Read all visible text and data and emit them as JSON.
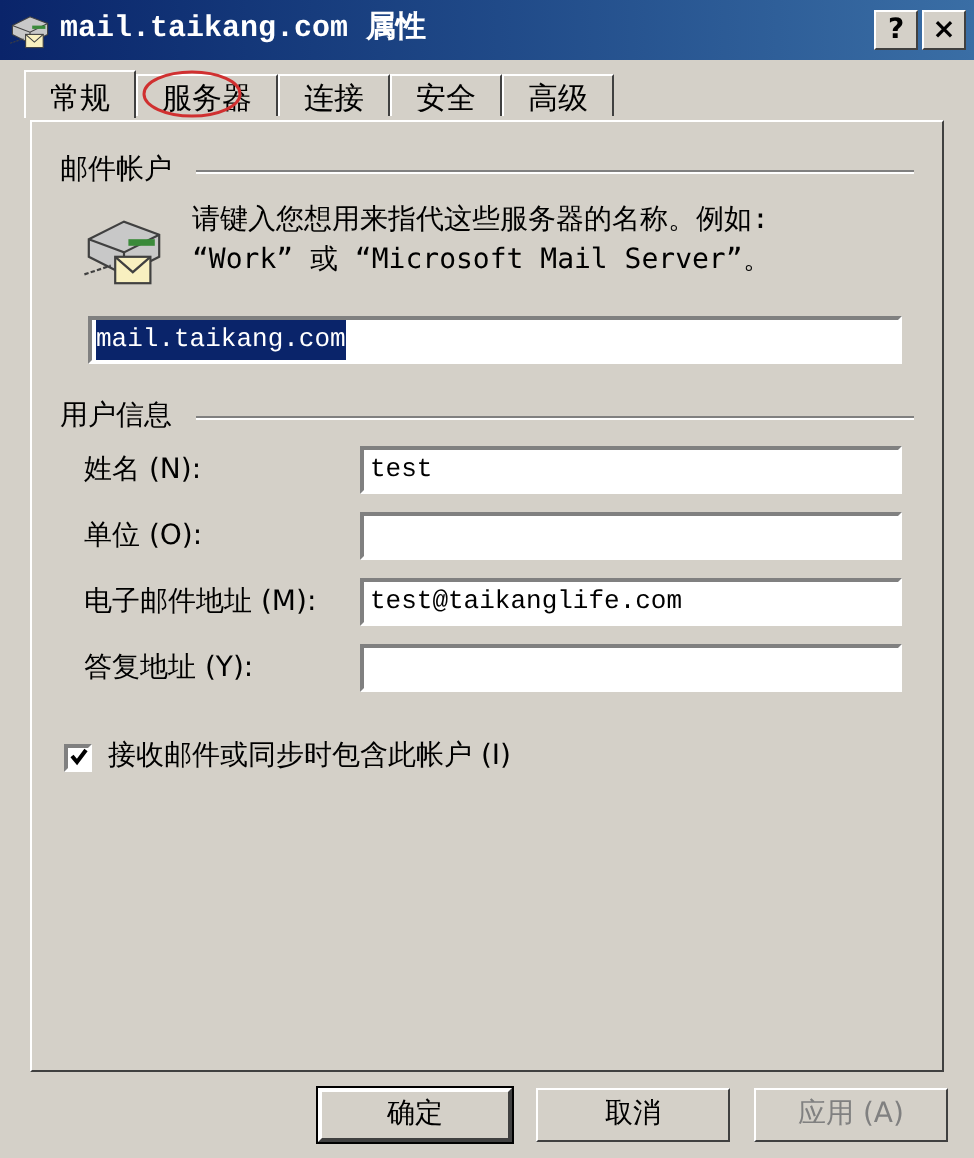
{
  "window": {
    "title": "mail.taikang.com 属性",
    "buttons": [
      "?",
      "×"
    ]
  },
  "tabs": [
    {
      "label": "常规",
      "selected": true,
      "circled": false
    },
    {
      "label": "服务器",
      "selected": false,
      "circled": true
    },
    {
      "label": "连接",
      "selected": false,
      "circled": false
    },
    {
      "label": "安全",
      "selected": false,
      "circled": false
    },
    {
      "label": "高级",
      "selected": false,
      "circled": false
    }
  ],
  "mail_account": {
    "heading": "邮件帐户",
    "description_lines": [
      "请键入您想用来指代这些服务器的名称。例如:",
      "“Work” 或 “Microsoft Mail Server”。"
    ],
    "value": "mail.taikang.com",
    "selected": true
  },
  "user_info": {
    "heading": "用户信息",
    "fields": [
      {
        "label": "姓名 (N):",
        "value": "test"
      },
      {
        "label": "单位 (O):"
      },
      {
        "label": "电子邮件地址 (M):",
        "value": "test@taikanglife.com"
      },
      {
        "label": "答复地址 (Y):"
      }
    ]
  },
  "include_account": {
    "label": "接收邮件或同步时包含此帐户 (I)",
    "checked": true
  },
  "buttons": [
    {
      "label": "确定",
      "disabled": false,
      "default": true
    },
    {
      "label": "取消",
      "disabled": false,
      "default": false
    },
    {
      "label": "应用 (A)",
      "disabled": true,
      "default": false
    }
  ]
}
